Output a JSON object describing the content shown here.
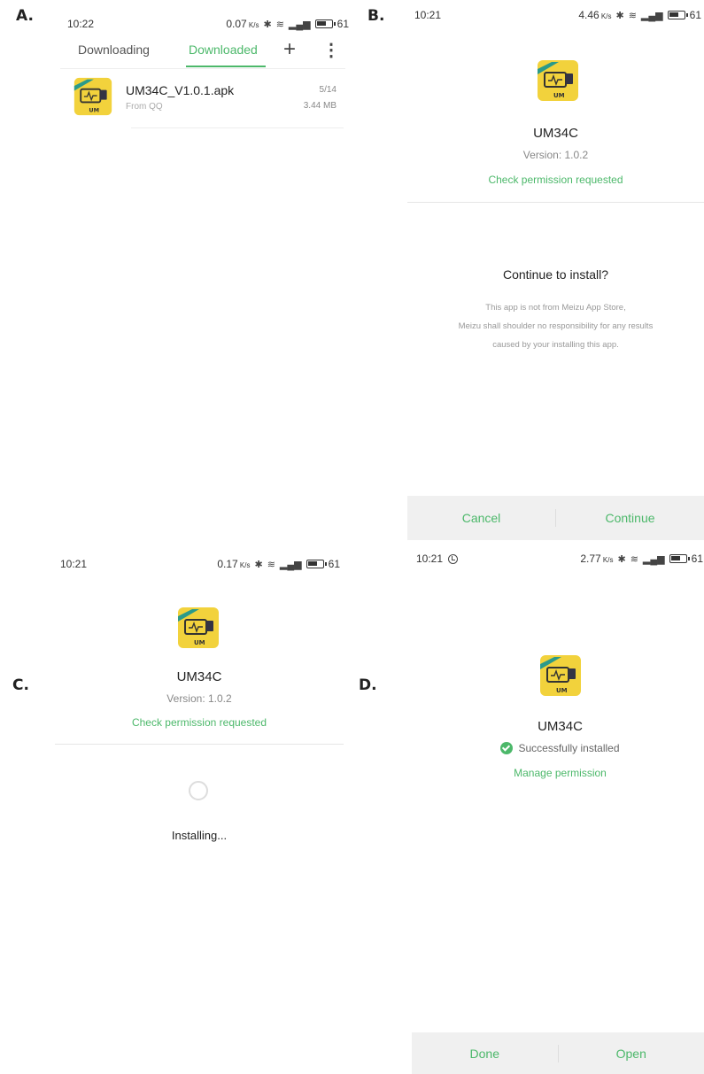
{
  "panels": {
    "a": {
      "label": "A.",
      "status": {
        "time": "10:22",
        "speed": "0.07",
        "battery": "61"
      },
      "tabs": {
        "downloading": "Downloading",
        "downloaded": "Downloaded"
      },
      "add_icon": "plus-icon",
      "more_icon": "more-vertical-icon",
      "file": {
        "name": "UM34C_V1.0.1.apk",
        "source": "From QQ",
        "date": "5/14",
        "size": "3.44 MB"
      }
    },
    "b": {
      "label": "B.",
      "status": {
        "time": "10:21",
        "speed": "4.46",
        "battery": "61"
      },
      "app_name": "UM34C",
      "version": "Version: 1.0.2",
      "permission_link": "Check permission requested",
      "dialog_title": "Continue to install?",
      "warning_lines": [
        "This app is not from Meizu App Store,",
        "Meizu shall shoulder no responsibility for any results",
        "caused by your installing this app."
      ],
      "cancel": "Cancel",
      "continue": "Continue"
    },
    "c": {
      "label": "C.",
      "status": {
        "time": "10:21",
        "speed": "0.17",
        "battery": "61"
      },
      "app_name": "UM34C",
      "version": "Version: 1.0.2",
      "permission_link": "Check permission requested",
      "installing": "Installing..."
    },
    "d": {
      "label": "D.",
      "status": {
        "time": "10:21",
        "speed": "2.77",
        "battery": "61"
      },
      "app_name": "UM34C",
      "success": "Successfully installed",
      "manage_link": "Manage permission",
      "done": "Done",
      "open": "Open"
    }
  },
  "colors": {
    "accent": "#4cb86a",
    "icon_yellow": "#f2d23c",
    "icon_teal": "#2b9a8a",
    "button_bar": "#f0f0f0"
  }
}
